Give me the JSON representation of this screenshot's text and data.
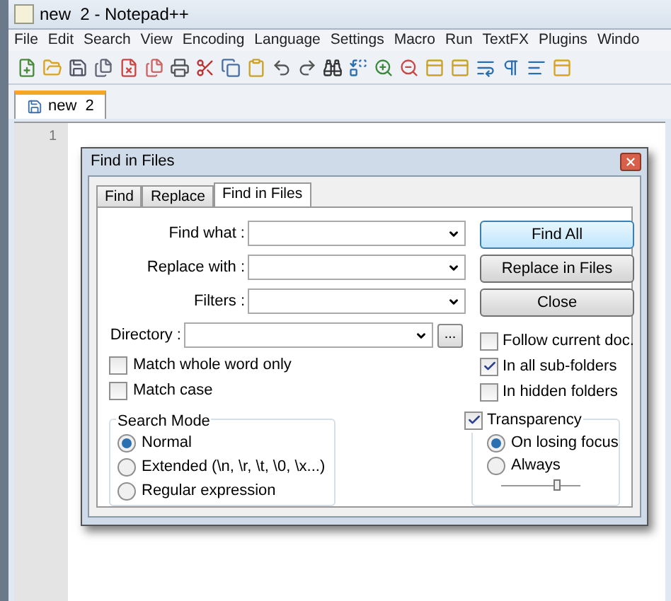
{
  "window": {
    "title": "new  2 - Notepad++"
  },
  "menu": [
    "File",
    "Edit",
    "Search",
    "View",
    "Encoding",
    "Language",
    "Settings",
    "Macro",
    "Run",
    "TextFX",
    "Plugins",
    "Windo"
  ],
  "tabs": [
    {
      "label": "new  2",
      "selected": true
    }
  ],
  "editor": {
    "line_numbers": [
      "1"
    ]
  },
  "dialog": {
    "title": "Find in Files",
    "tabs": [
      {
        "label": "Find",
        "selected": false
      },
      {
        "label": "Replace",
        "selected": false
      },
      {
        "label": "Find in Files",
        "selected": true
      }
    ],
    "fields": [
      {
        "label": "Find what :"
      },
      {
        "label": "Replace with :"
      },
      {
        "label": "Filters :"
      }
    ],
    "directory": {
      "label": "Directory :",
      "browse": "..."
    },
    "options": [
      {
        "label": "Match whole word only",
        "checked": false
      },
      {
        "label": "Match case",
        "checked": false
      }
    ],
    "buttons": [
      {
        "label": "Find All",
        "default": true
      },
      {
        "label": "Replace in Files",
        "default": false
      },
      {
        "label": "Close",
        "default": false
      }
    ],
    "folder_options": [
      {
        "label": "Follow current doc.",
        "checked": false
      },
      {
        "label": "In all sub-folders",
        "checked": true
      },
      {
        "label": "In hidden folders",
        "checked": false
      }
    ],
    "search_mode": {
      "title": "Search Mode",
      "options": [
        {
          "label": "Normal",
          "selected": true
        },
        {
          "label": "Extended (\\n, \\r, \\t, \\0, \\x...)",
          "selected": false
        },
        {
          "label": "Regular expression",
          "selected": false
        }
      ]
    },
    "transparency": {
      "label": "Transparency",
      "checked": true,
      "options": [
        {
          "label": "On losing focus",
          "selected": true
        },
        {
          "label": "Always",
          "selected": false
        }
      ],
      "level": 0.7
    }
  }
}
